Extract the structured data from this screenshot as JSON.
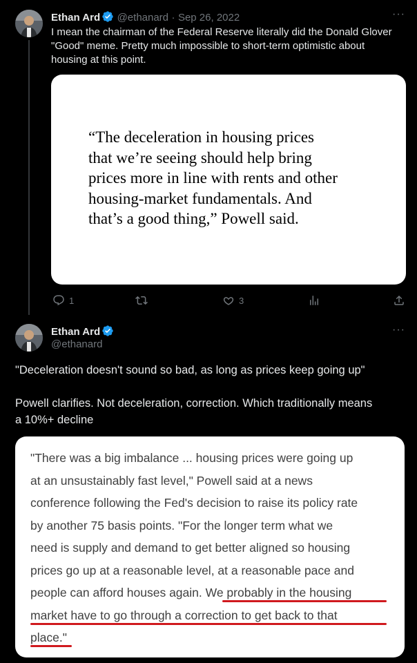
{
  "tweet1": {
    "author_name": "Ethan Ard",
    "handle": "@ethanard",
    "separator": "·",
    "date": "Sep 26, 2022",
    "more_icon": "more-icon",
    "text_lines": [
      "I mean the chairman of the Federal Reserve literally did the Donald Glover",
      "\"Good\" meme.  Pretty much impossible to short-term optimistic about",
      "housing at this point."
    ],
    "image_quote_lines": [
      "“The deceleration in housing prices",
      "that we’re seeing should help bring",
      "prices more in line with rents and other",
      "housing-market fundamentals. And",
      "that’s a good thing,” Powell said."
    ],
    "reply_count": "1",
    "retweet_count": "",
    "like_count": "3"
  },
  "tweet2": {
    "author_name": "Ethan Ard",
    "handle": "@ethanard",
    "text_para1": "\"Deceleration doesn't sound so bad, as long as prices keep going up\"",
    "text_para2_lines": [
      "Powell clarifies.  Not deceleration, correction.  Which traditionally means",
      "a 10%+ decline"
    ],
    "image_quote_lines": [
      "\"There was a big imbalance ... housing prices were going up",
      "at an unsustainably fast level,\" Powell said at a news",
      "conference following the Fed's decision to raise its policy rate",
      "by another 75 basis points. \"For the longer term what we",
      "need is supply and demand to get better aligned so housing",
      "prices go up at a reasonable level, at a reasonable pace and",
      "people can afford houses again. We probably in the housing",
      "market have to go through a correction to get back to that",
      "place.\""
    ],
    "underline_color": "#d0191e"
  },
  "colors": {
    "background": "#000000",
    "text": "#e7e9ea",
    "muted": "#71767b",
    "verified": "#1d9bf0"
  }
}
